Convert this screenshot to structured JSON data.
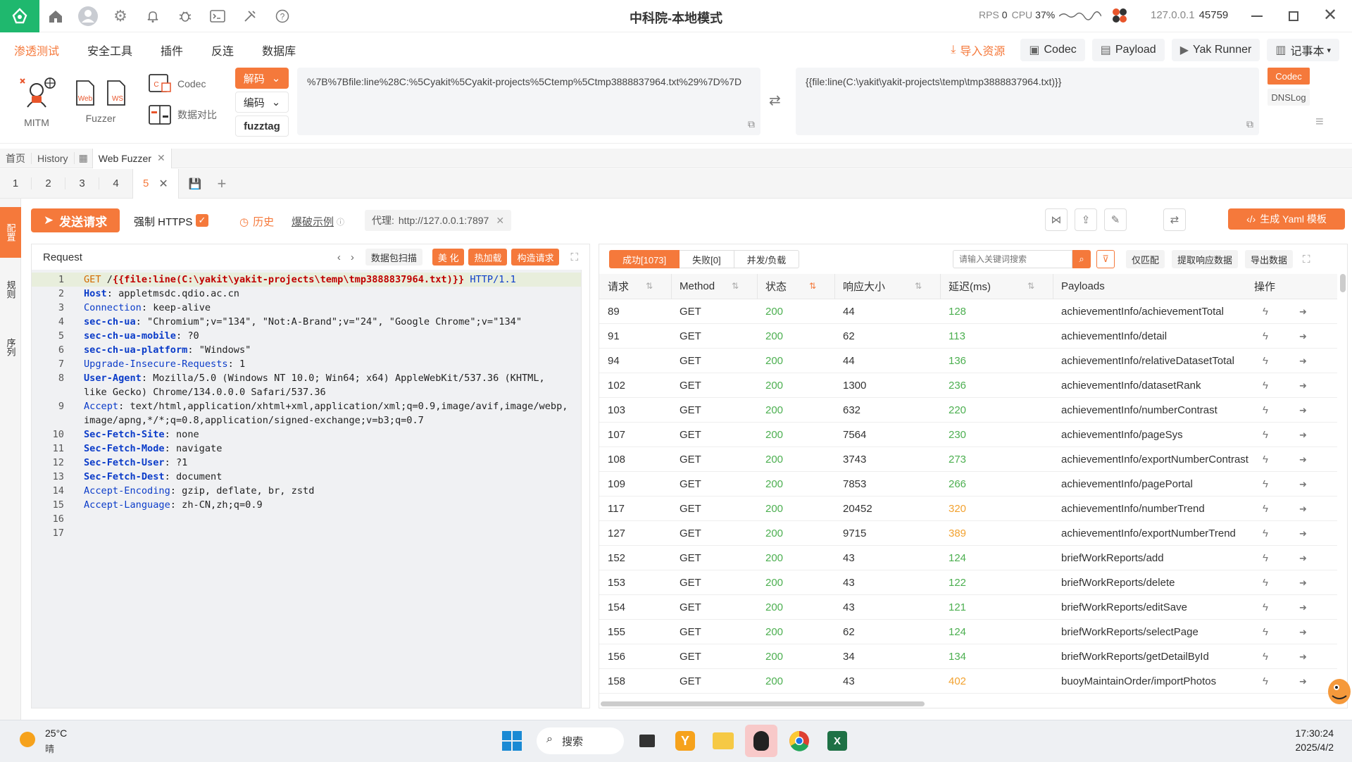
{
  "window": {
    "title": "中科院-本地模式",
    "rps_label": "RPS",
    "rps_value": "0",
    "cpu_label": "CPU",
    "cpu_value": "37%",
    "address": "127.0.0.1",
    "port": "45759"
  },
  "menu": {
    "items": [
      "渗透测试",
      "安全工具",
      "插件",
      "反连",
      "数据库"
    ],
    "import_label": "导入资源",
    "codec_label": "Codec",
    "payload_label": "Payload",
    "runner_label": "Yak Runner",
    "notebook_label": "记事本"
  },
  "toolbox": {
    "mitm_label": "MITM",
    "fuzzer_label": "Fuzzer",
    "codec_label": "Codec",
    "compare_label": "数据对比",
    "decode_label": "解码",
    "encode_label": "编码",
    "fuzztag_label": "fuzztag",
    "codec_input": "%7B%7Bfile:line%28C:%5Cyakit%5Cyakit-projects%5Ctemp%5Ctmp3888837964.txt%29%7D%7D",
    "codec_output": "{{file:line(C:\\yakit\\yakit-projects\\temp\\tmp3888837964.txt)}}",
    "side_codec": "Codec",
    "side_dnslog": "DNSLog"
  },
  "tabs": {
    "home": "首页",
    "history": "History",
    "fuzzer": "Web Fuzzer",
    "sub": [
      "1",
      "2",
      "3",
      "4",
      "5"
    ]
  },
  "side": {
    "labels": [
      "配置",
      "规则",
      "序列"
    ]
  },
  "fuzzbar": {
    "send_label": "发送请求",
    "https_label": "强制 HTTPS",
    "history_label": "历史",
    "example_label": "爆破示例",
    "proxy_label": "代理:",
    "proxy_value": "http://127.0.0.1:7897",
    "yaml_label": "生成 Yaml 模板"
  },
  "request": {
    "title": "Request",
    "scan_label": "数据包扫描",
    "beautify_label": "美 化",
    "hotload_label": "热加载",
    "build_label": "构造请求",
    "lines": [
      {
        "n": "1",
        "method": "GET",
        "pre": " /",
        "tag": "{{file:line(C:\\yakit\\yakit-projects\\temp\\tmp3888837964.txt)}}",
        "post": " HTTP/1.1"
      },
      {
        "n": "2",
        "key": "Host",
        "val": " appletmsdc.qdio.ac.cn"
      },
      {
        "n": "3",
        "key": "Connection",
        "val": " keep-alive",
        "plain": true
      },
      {
        "n": "4",
        "key": "sec-ch-ua",
        "val": " \"Chromium\";v=\"134\", \"Not:A-Brand\";v=\"24\", \"Google Chrome\";v=\"134\""
      },
      {
        "n": "5",
        "key": "sec-ch-ua-mobile",
        "val": " ?0"
      },
      {
        "n": "6",
        "key": "sec-ch-ua-platform",
        "val": " \"Windows\""
      },
      {
        "n": "7",
        "key": "Upgrade-Insecure-Requests",
        "val": " 1",
        "plain": true
      },
      {
        "n": "8",
        "key": "User-Agent",
        "val": " Mozilla/5.0 (Windows NT 10.0; Win64; x64) AppleWebKit/537.36 (KHTML,",
        "cont": "like Gecko) Chrome/134.0.0.0 Safari/537.36"
      },
      {
        "n": "9",
        "key": "Accept",
        "val": " text/html,application/xhtml+xml,application/xml;q=0.9,image/avif,image/webp,",
        "cont": "image/apng,*/*;q=0.8,application/signed-exchange;v=b3;q=0.7",
        "plain": true
      },
      {
        "n": "10",
        "key": "Sec-Fetch-Site",
        "val": " none"
      },
      {
        "n": "11",
        "key": "Sec-Fetch-Mode",
        "val": " navigate"
      },
      {
        "n": "12",
        "key": "Sec-Fetch-User",
        "val": " ?1"
      },
      {
        "n": "13",
        "key": "Sec-Fetch-Dest",
        "val": " document"
      },
      {
        "n": "14",
        "key": "Accept-Encoding",
        "val": " gzip, deflate, br, zstd",
        "plain": true
      },
      {
        "n": "15",
        "key": "Accept-Language",
        "val": " zh-CN,zh;q=0.9",
        "plain": true
      },
      {
        "n": "16"
      },
      {
        "n": "17"
      }
    ]
  },
  "response": {
    "success_label": "成功[1073]",
    "fail_label": "失败[0]",
    "concurrency_label": "并发/负载",
    "search_placeholder": "请输入关键词搜索",
    "match_only_label": "仅匹配",
    "extract_label": "提取响应数据",
    "export_label": "导出数据",
    "columns": [
      "请求",
      "Method",
      "状态",
      "响应大小",
      "延迟(ms)",
      "Payloads",
      "操作"
    ],
    "rows": [
      {
        "id": "89",
        "method": "GET",
        "status": "200",
        "size": "44",
        "latency": "128",
        "warn": false,
        "payload": "achievementInfo/achievementTotal"
      },
      {
        "id": "91",
        "method": "GET",
        "status": "200",
        "size": "62",
        "latency": "113",
        "warn": false,
        "payload": "achievementInfo/detail"
      },
      {
        "id": "94",
        "method": "GET",
        "status": "200",
        "size": "44",
        "latency": "136",
        "warn": false,
        "payload": "achievementInfo/relativeDatasetTotal"
      },
      {
        "id": "102",
        "method": "GET",
        "status": "200",
        "size": "1300",
        "latency": "236",
        "warn": false,
        "payload": "achievementInfo/datasetRank"
      },
      {
        "id": "103",
        "method": "GET",
        "status": "200",
        "size": "632",
        "latency": "220",
        "warn": false,
        "payload": "achievementInfo/numberContrast"
      },
      {
        "id": "107",
        "method": "GET",
        "status": "200",
        "size": "7564",
        "latency": "230",
        "warn": false,
        "payload": "achievementInfo/pageSys"
      },
      {
        "id": "108",
        "method": "GET",
        "status": "200",
        "size": "3743",
        "latency": "273",
        "warn": false,
        "payload": "achievementInfo/exportNumberContrast"
      },
      {
        "id": "109",
        "method": "GET",
        "status": "200",
        "size": "7853",
        "latency": "266",
        "warn": false,
        "payload": "achievementInfo/pagePortal"
      },
      {
        "id": "117",
        "method": "GET",
        "status": "200",
        "size": "20452",
        "latency": "320",
        "warn": true,
        "payload": "achievementInfo/numberTrend"
      },
      {
        "id": "127",
        "method": "GET",
        "status": "200",
        "size": "9715",
        "latency": "389",
        "warn": true,
        "payload": "achievementInfo/exportNumberTrend"
      },
      {
        "id": "152",
        "method": "GET",
        "status": "200",
        "size": "43",
        "latency": "124",
        "warn": false,
        "payload": "briefWorkReports/add"
      },
      {
        "id": "153",
        "method": "GET",
        "status": "200",
        "size": "43",
        "latency": "122",
        "warn": false,
        "payload": "briefWorkReports/delete"
      },
      {
        "id": "154",
        "method": "GET",
        "status": "200",
        "size": "43",
        "latency": "121",
        "warn": false,
        "payload": "briefWorkReports/editSave"
      },
      {
        "id": "155",
        "method": "GET",
        "status": "200",
        "size": "62",
        "latency": "124",
        "warn": false,
        "payload": "briefWorkReports/selectPage"
      },
      {
        "id": "156",
        "method": "GET",
        "status": "200",
        "size": "34",
        "latency": "134",
        "warn": false,
        "payload": "briefWorkReports/getDetailById"
      },
      {
        "id": "158",
        "method": "GET",
        "status": "200",
        "size": "43",
        "latency": "402",
        "warn": true,
        "payload": "buoyMaintainOrder/importPhotos"
      }
    ]
  },
  "taskbar": {
    "temperature": "25°C",
    "weather": "晴",
    "search_label": "搜索",
    "time": "17:30:24",
    "date": "2025/4/2"
  },
  "colors": {
    "accent": "#f5793b",
    "brand": "#1fb86e",
    "ok": "#4caf50",
    "warn": "#f2a230"
  }
}
